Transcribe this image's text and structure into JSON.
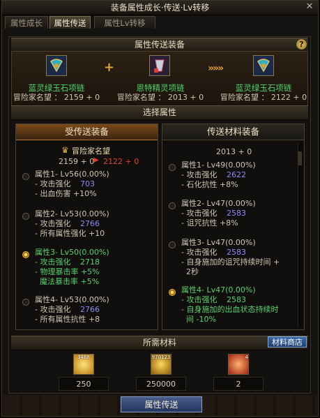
{
  "window": {
    "title": "装备属性成长·传送·Lv转移"
  },
  "tabs": [
    "属性成长",
    "属性传送",
    "属性Lv转移"
  ],
  "headers": {
    "transfer_equipment": "属性传送装备",
    "select_attribute": "选择属性",
    "required_materials": "所需材料"
  },
  "banner": {
    "left": {
      "name": "蓝灵绿玉石项链",
      "rep": "冒险家名望 ： 2159 + 0"
    },
    "middle": {
      "name": "恩特精灵项链",
      "rep": "冒险家名望 ： 2013 + 0"
    },
    "right": {
      "name": "蓝灵绿玉石项链",
      "rep": "冒险家名望 ： 2122 + 0"
    }
  },
  "left_col": {
    "title": "受传送装备",
    "rep_label": "冒险家名望",
    "rep_before": "2159 + 0",
    "rep_after": "2122 + 0",
    "attrs": [
      {
        "title": "属性1- Lv56(0.00%)",
        "atk_label": "- 攻击强化",
        "atk_value": "703",
        "lines": [
          "- 出血伤害 +10%"
        ]
      },
      {
        "title": "属性2- Lv53(0.00%)",
        "atk_label": "- 攻击强化",
        "atk_value": "2766",
        "lines": [
          "- 所有属性强化 +10"
        ]
      },
      {
        "title": "属性3- Lv50(0.00%)",
        "atk_label": "- 攻击强化",
        "atk_value": "2718",
        "lines": [
          "- 物理暴击率 +5%",
          "  魔法暴击率 +5%"
        ]
      },
      {
        "title": "属性4- Lv53(0.00%)",
        "atk_label": "- 攻击强化",
        "atk_value": "2766",
        "lines": [
          "- 所有属性抗性 +8"
        ]
      }
    ]
  },
  "right_col": {
    "title": "传送材料装备",
    "rep": "2013 + 0",
    "attrs": [
      {
        "title": "属性1- Lv49(0.00%)",
        "atk_label": "- 攻击强化",
        "atk_value": "2622",
        "lines": [
          "- 石化抗性 +8%"
        ]
      },
      {
        "title": "属性2- Lv47(0.00%)",
        "atk_label": "- 攻击强化",
        "atk_value": "2583",
        "lines": [
          "- 诅咒抗性 +8%"
        ]
      },
      {
        "title": "属性3- Lv47(0.00%)",
        "atk_label": "- 攻击强化",
        "atk_value": "2583",
        "lines": [
          "- 自身施加的诅咒持续时间 +",
          "  2秒"
        ]
      },
      {
        "title": "属性4- Lv47(0.00%)",
        "atk_label": "- 攻击强化",
        "atk_value": "2583",
        "lines": [
          "- 自身施加的出血状态持续时",
          "  间 -10%"
        ]
      }
    ]
  },
  "materials": {
    "shop_button": "材料商店",
    "items": [
      {
        "icon": "gold-gem-icon",
        "badge": "3468",
        "amount": "250"
      },
      {
        "icon": "gold-coins-icon",
        "badge": "970123",
        "amount": "250000"
      },
      {
        "icon": "fire-stone-icon",
        "badge": "4",
        "amount": "2"
      }
    ]
  },
  "footer": {
    "transfer_button": "属性传送"
  },
  "colors": {
    "green": "#57d26a",
    "blue": "#8c8cf5",
    "red": "#e04030",
    "gold": "#e0a53a"
  }
}
